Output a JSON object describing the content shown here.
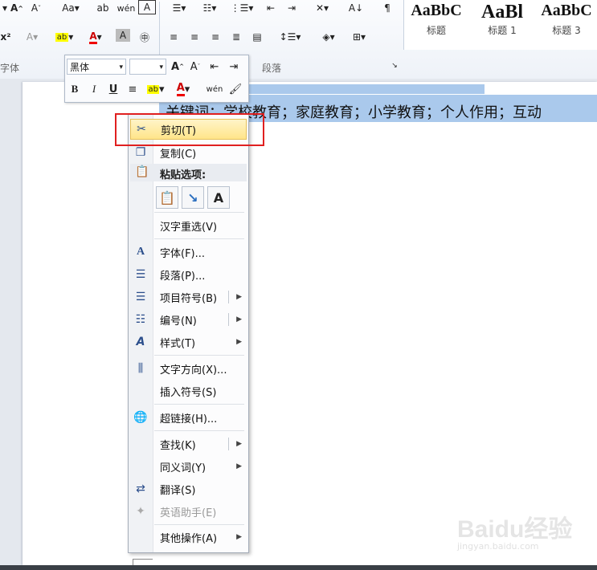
{
  "ribbon": {
    "group_font": "字体",
    "group_paragraph": "段落",
    "styles": [
      {
        "sample": "AaBbC",
        "name": "标题"
      },
      {
        "sample": "AaBl",
        "name": "标题 1"
      },
      {
        "sample": "AaBbC",
        "name": "标题 3"
      }
    ]
  },
  "document": {
    "text": "关键词：学校教育；家庭教育；小学教育；个人作用；互动"
  },
  "mini_toolbar": {
    "font_name": "黑体",
    "font_size": ""
  },
  "context_menu": {
    "items": [
      {
        "label": "剪切(T)",
        "icon": "scissors-icon"
      },
      {
        "label": "复制(C)",
        "icon": "copy-icon"
      },
      {
        "label": "汉字重选(V)"
      },
      {
        "label": "字体(F)...",
        "icon": "font-icon"
      },
      {
        "label": "段落(P)...",
        "icon": "paragraph-icon"
      },
      {
        "label": "项目符号(B)",
        "icon": "bullets-icon"
      },
      {
        "label": "编号(N)",
        "icon": "numbering-icon"
      },
      {
        "label": "样式(T)",
        "icon": "styles-icon"
      },
      {
        "label": "文字方向(X)...",
        "icon": "text-direction-icon"
      },
      {
        "label": "插入符号(S)"
      },
      {
        "label": "超链接(H)...",
        "icon": "hyperlink-icon"
      },
      {
        "label": "查找(K)"
      },
      {
        "label": "同义词(Y)"
      },
      {
        "label": "翻译(S)",
        "icon": "translate-icon"
      },
      {
        "label": "英语助手(E)",
        "icon": "english-assistant-icon"
      },
      {
        "label": "其他操作(A)"
      }
    ],
    "paste_options_label": "粘贴选项:"
  },
  "watermark": {
    "text": "Baidu经验",
    "sub": "jingyan.baidu.com"
  }
}
